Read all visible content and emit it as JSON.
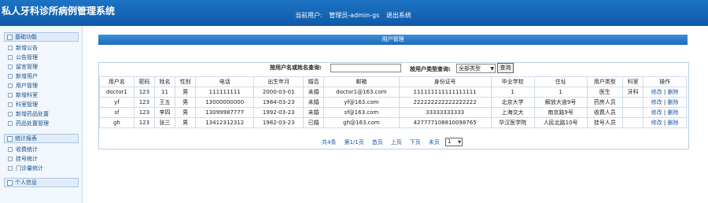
{
  "app": {
    "title": "私人牙科诊所病例管理系统"
  },
  "userbar": {
    "label": "当前用户:",
    "user": "管理员-admin-gs",
    "logout": "退出系统"
  },
  "sidebar": {
    "groups": [
      {
        "label": "基础功能",
        "items": [
          "新增公告",
          "公告管理",
          "留言管理",
          "新增用户",
          "用户管理",
          "新增科室",
          "科室管理",
          "新增药品处置",
          "药品处置管理"
        ]
      },
      {
        "label": "统计报表",
        "items": [
          "收费统计",
          "挂号统计",
          "门诊量统计"
        ]
      },
      {
        "label": "个人信息",
        "items": []
      }
    ]
  },
  "panel": {
    "title": "用户管理"
  },
  "search": {
    "name_label": "按用户名或姓名查询:",
    "name_value": "",
    "type_label": "按用户类型查询:",
    "type_selected": "全部类型",
    "query_button": "查询"
  },
  "table": {
    "headers": [
      "用户名",
      "密码",
      "姓名",
      "性别",
      "电话",
      "出生年月",
      "婚否",
      "邮箱",
      "身份证号",
      "毕业学校",
      "住址",
      "用户类型",
      "科室",
      "操作"
    ],
    "rows": [
      [
        "doctor1",
        "123",
        "11",
        "男",
        "111111111",
        "2000-03-01",
        "未婚",
        "doctor1@163.com",
        "111111111111111111",
        "1",
        "1",
        "医生",
        "牙科"
      ],
      [
        "yf",
        "123",
        "王五",
        "男",
        "13000000000",
        "1984-03-23",
        "未婚",
        "yf@163.com",
        "222222222222222222",
        "北京大学",
        "解放大道9号",
        "药房人员",
        ""
      ],
      [
        "sf",
        "123",
        "李四",
        "男",
        "13099987777",
        "1992-03-23",
        "未婚",
        "sf@163.com",
        "33333333333",
        "上海交大",
        "南京路9号",
        "收费人员",
        ""
      ],
      [
        "gh",
        "123",
        "张三",
        "男",
        "13412312312",
        "1982-03-23",
        "已婚",
        "gh@163.com",
        "427777108810098765",
        "华汉医学院",
        "人民北路10号",
        "挂号人员",
        ""
      ]
    ],
    "edit_label": "修改",
    "sep": "|",
    "delete_label": "删除"
  },
  "pager": {
    "total": "共4条",
    "page_info": "第1/1页",
    "first": "首页",
    "prev": "上页",
    "next": "下页",
    "last": "末页",
    "page_selected": "1"
  }
}
